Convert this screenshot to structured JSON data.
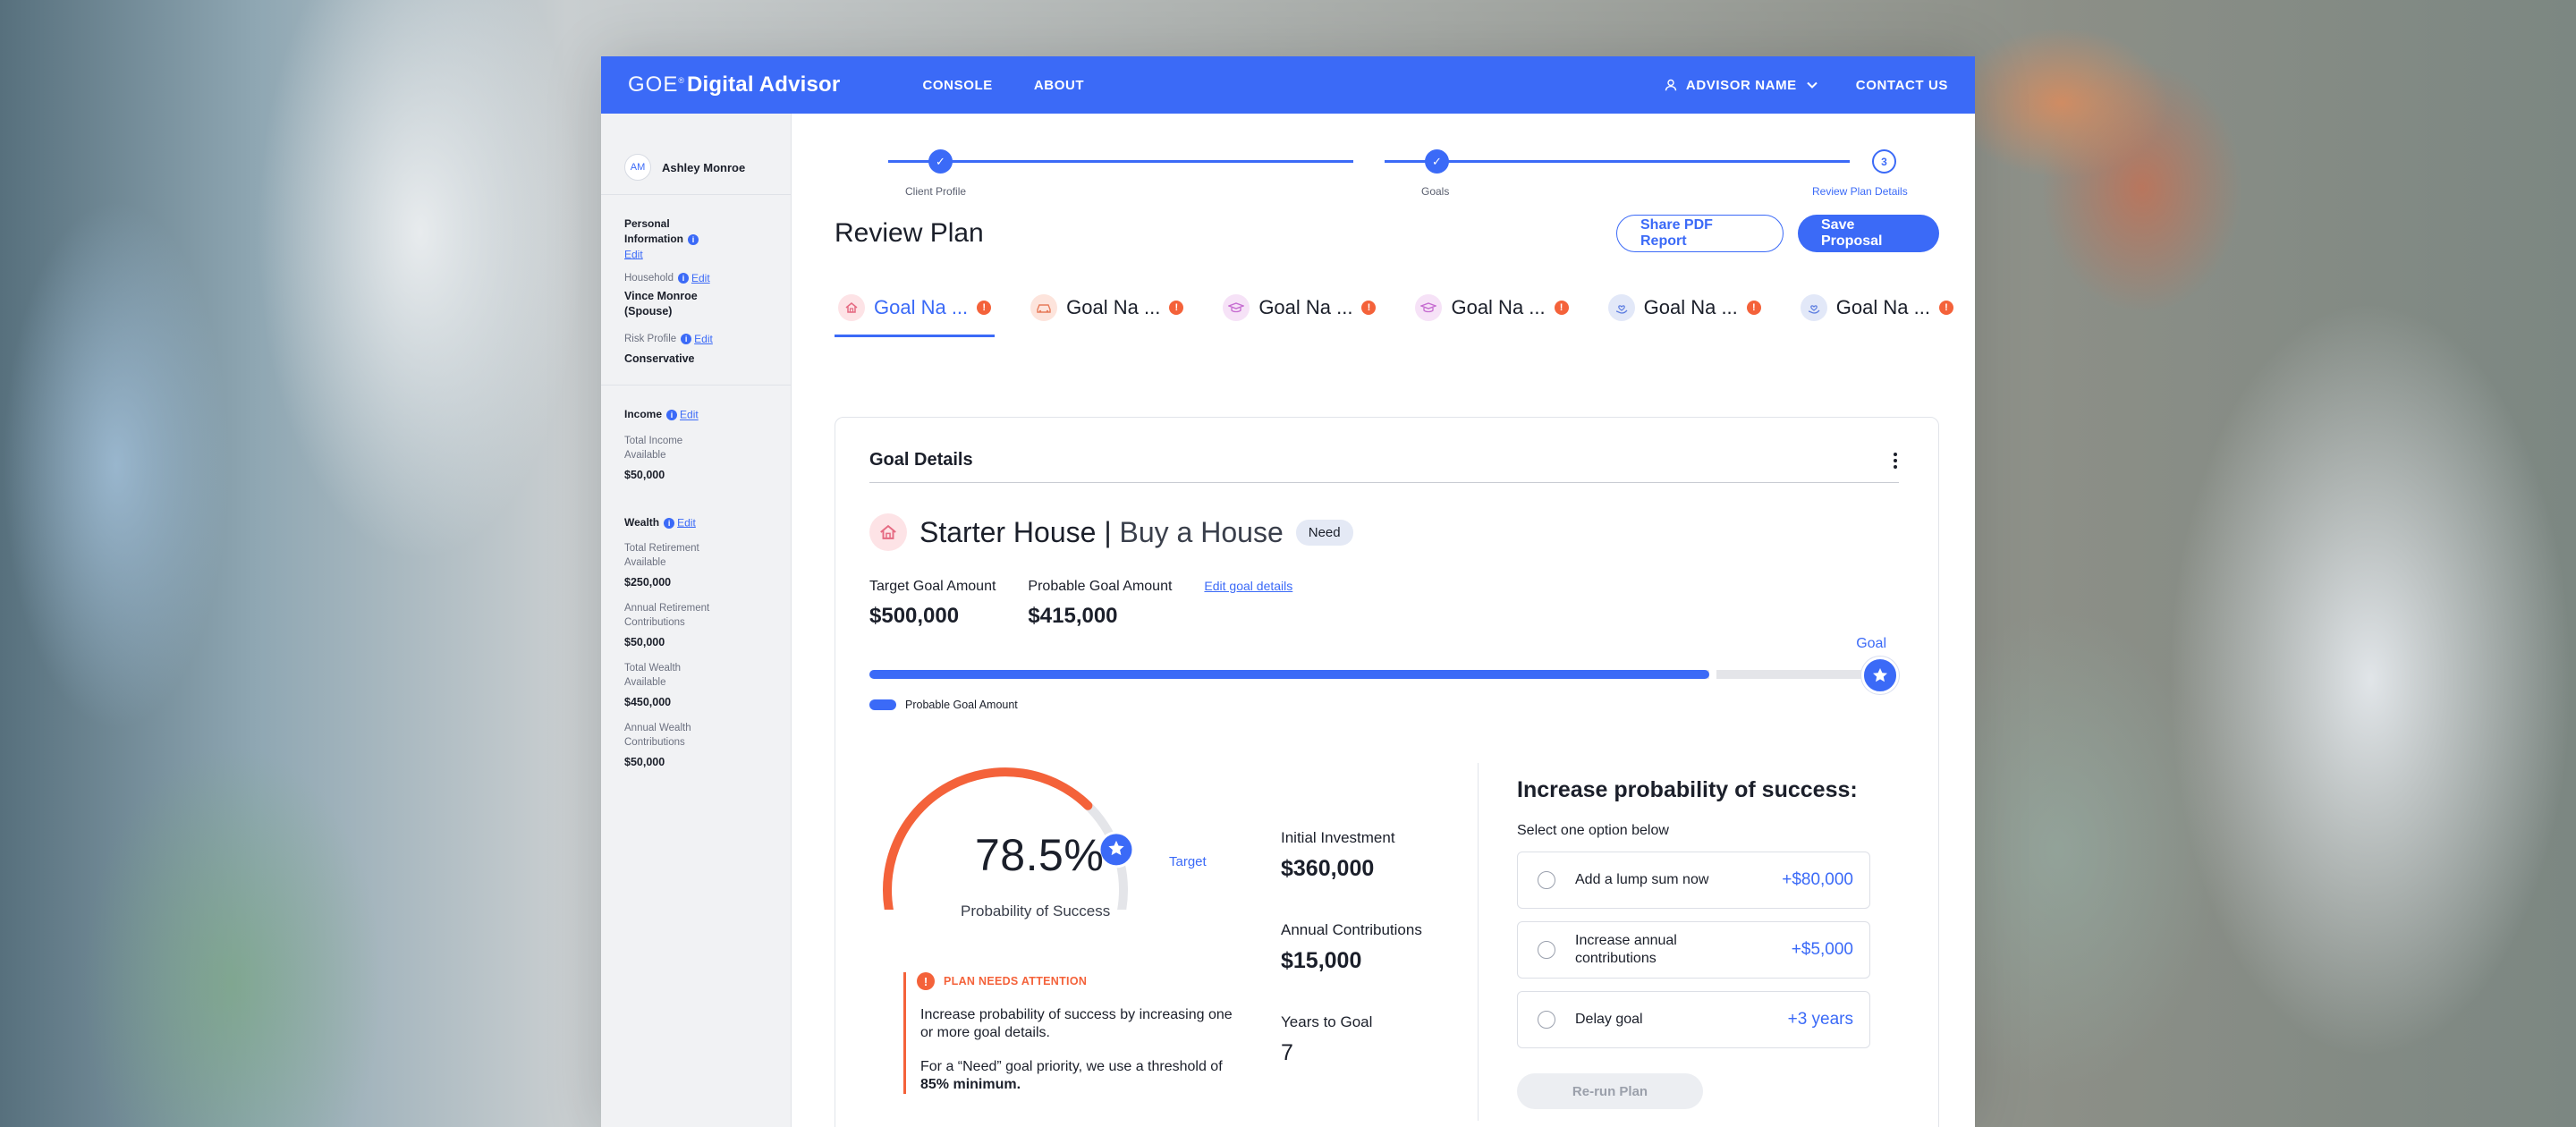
{
  "app": {
    "logo_goe": "GOE",
    "logo_mark": "®",
    "logo_product": "Digital Advisor",
    "nav": [
      "CONSOLE",
      "ABOUT"
    ],
    "advisor_name": "ADVISOR NAME",
    "contact": "CONTACT US"
  },
  "sidebar": {
    "client_initials": "AM",
    "client_name": "Ashley Monroe",
    "personal_info_label": "Personal Information",
    "household_label": "Household",
    "household_value": "Vince Monroe (Spouse)",
    "risk_label": "Risk Profile",
    "risk_value": "Conservative",
    "edit": "Edit",
    "income_label": "Income",
    "total_income_label": "Total Income Available",
    "total_income_value": "$50,000",
    "wealth_label": "Wealth",
    "total_retirement_label": "Total Retirement Available",
    "total_retirement_value": "$250,000",
    "annual_retirement_label": "Annual Retirement Contributions",
    "annual_retirement_value": "$50,000",
    "total_wealth_label": "Total Wealth Available",
    "total_wealth_value": "$450,000",
    "annual_wealth_label": "Annual Wealth Contributions",
    "annual_wealth_value": "$50,000"
  },
  "stepper": {
    "steps": [
      {
        "label": "Client Profile",
        "state": "done",
        "marker": "✓"
      },
      {
        "label": "Goals",
        "state": "done",
        "marker": "✓"
      },
      {
        "label": "Review Plan Details",
        "state": "current",
        "marker": "3"
      }
    ]
  },
  "header": {
    "title": "Review Plan",
    "share_label": "Share PDF Report",
    "save_label": "Save Proposal"
  },
  "goal_tabs": [
    {
      "label": "Goal Na ...",
      "icon": "house-icon",
      "color": "#fde3e6",
      "alert": "!"
    },
    {
      "label": "Goal Na ...",
      "icon": "car-icon",
      "color": "#fde4dc",
      "alert": "!"
    },
    {
      "label": "Goal Na ...",
      "icon": "graduation-cap-icon",
      "color": "#f6e2f7",
      "alert": "!"
    },
    {
      "label": "Goal Na ...",
      "icon": "graduation-cap-icon",
      "color": "#f6e2f7",
      "alert": "!"
    },
    {
      "label": "Goal Na ...",
      "icon": "hand-heart-icon",
      "color": "#e2e8f8",
      "alert": "!"
    },
    {
      "label": "Goal Na ...",
      "icon": "hand-heart-icon",
      "color": "#e2e8f8",
      "alert": "!"
    }
  ],
  "goal_details": {
    "title": "Goal Details",
    "goal_name": "Starter House",
    "separator": "|",
    "goal_type": "Buy a House",
    "priority": "Need",
    "target_label": "Target Goal Amount",
    "target_value": "$500,000",
    "probable_label": "Probable Goal Amount",
    "probable_value": "$415,000",
    "edit_link": "Edit goal details",
    "goal_tag": "Goal",
    "legend_label": "Probable Goal Amount",
    "progress_fraction": 0.83
  },
  "gauge": {
    "value_text": "78.5%",
    "fraction": 0.785,
    "target_fraction": 0.85,
    "caption": "Probability of Success",
    "target_label": "Target"
  },
  "alert": {
    "marker": "!",
    "title": "PLAN NEEDS ATTENTION",
    "text1": "Increase probability of success by increasing one or more goal details.",
    "text2_prefix": "For a “Need” goal priority, we use a threshold of",
    "text2_bold": "85% minimum."
  },
  "stats": {
    "initial_label": "Initial Investment",
    "initial_value": "$360,000",
    "annual_label": "Annual Contributions",
    "annual_value": "$15,000",
    "years_label": "Years to Goal",
    "years_value": "7"
  },
  "increase": {
    "title": "Increase probability of success:",
    "subtitle": "Select one option below",
    "options": [
      {
        "label": "Add a lump sum now",
        "value": "+$80,000"
      },
      {
        "label": "Increase annual contributions",
        "value": "+$5,000"
      },
      {
        "label": "Delay goal",
        "value": "+3 years"
      }
    ],
    "rerun_label": "Re-run Plan"
  },
  "colors": {
    "primary": "#3b6af7",
    "alert": "#f4623a",
    "track": "#e4e5e9"
  }
}
